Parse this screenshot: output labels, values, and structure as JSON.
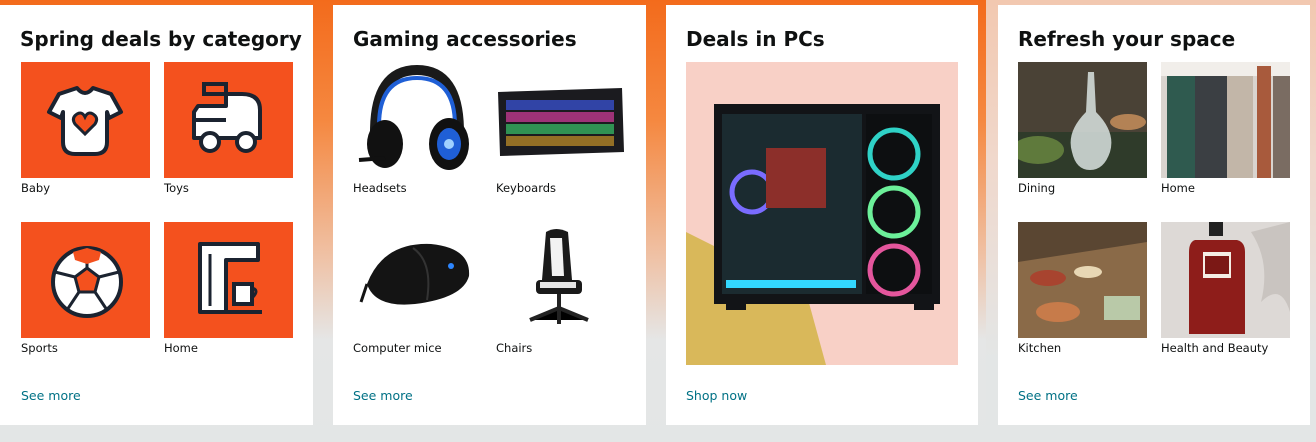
{
  "colors": {
    "accent": "#f4511e",
    "link": "#007185",
    "text": "#0f1111"
  },
  "cards": [
    {
      "title": "Spring deals by category",
      "link": "See more",
      "items": [
        {
          "label": "Baby",
          "icon": "onesie-icon"
        },
        {
          "label": "Toys",
          "icon": "toy-truck-icon"
        },
        {
          "label": "Sports",
          "icon": "soccer-ball-icon"
        },
        {
          "label": "Home",
          "icon": "coffee-maker-icon"
        }
      ]
    },
    {
      "title": "Gaming accessories",
      "link": "See more",
      "items": [
        {
          "label": "Headsets"
        },
        {
          "label": "Keyboards"
        },
        {
          "label": "Computer mice"
        },
        {
          "label": "Chairs"
        }
      ]
    },
    {
      "title": "Deals in PCs",
      "link": "Shop now"
    },
    {
      "title": "Refresh your space",
      "link": "See more",
      "items": [
        {
          "label": "Dining"
        },
        {
          "label": "Home"
        },
        {
          "label": "Kitchen"
        },
        {
          "label": "Health and Beauty"
        }
      ]
    }
  ]
}
